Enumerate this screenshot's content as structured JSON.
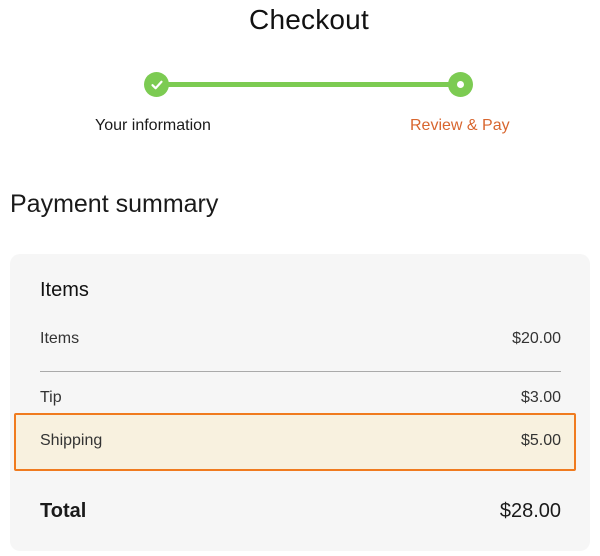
{
  "header": {
    "title": "Checkout"
  },
  "stepper": {
    "steps": [
      {
        "label": "Your information",
        "state": "completed"
      },
      {
        "label": "Review & Pay",
        "state": "current"
      }
    ],
    "colors": {
      "track": "#7ccb52",
      "current_label": "#d8662f"
    }
  },
  "payment_summary": {
    "heading": "Payment summary",
    "card_heading": "Items",
    "rows": [
      {
        "label": "Items",
        "amount": "$20.00"
      },
      {
        "label": "Tip",
        "amount": "$3.00"
      },
      {
        "label": "Shipping",
        "amount": "$5.00"
      }
    ],
    "total": {
      "label": "Total",
      "amount": "$28.00"
    },
    "highlight_color": "#f07b1f"
  }
}
